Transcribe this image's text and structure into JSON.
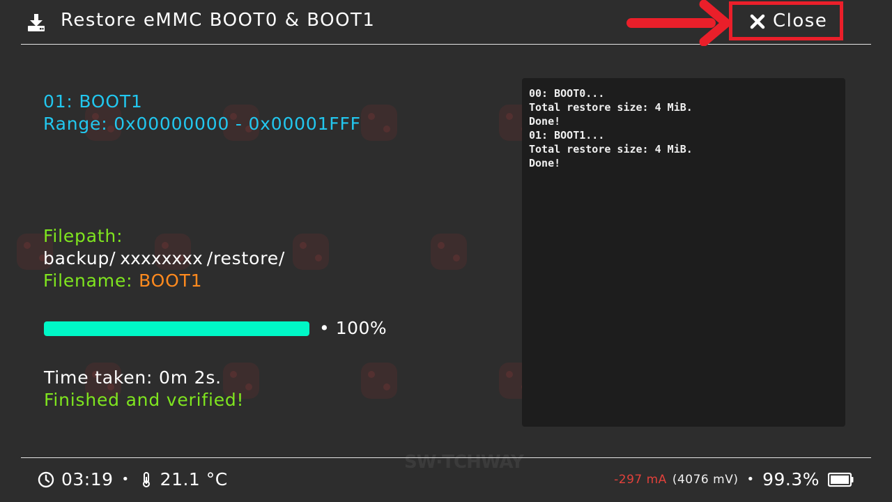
{
  "header": {
    "title": "Restore eMMC BOOT0 & BOOT1",
    "close_label": "Close"
  },
  "partition": {
    "name": "01: BOOT1",
    "range": "Range: 0x00000000 - 0x00001FFF"
  },
  "file": {
    "filepath_label": "Filepath:",
    "path_prefix": "backup/",
    "path_redacted": "xxxxxxxx",
    "path_suffix": "/restore/",
    "filename_label": "Filename:",
    "filename_value": "BOOT1"
  },
  "progress": {
    "value": 1.0,
    "text": "• 100%"
  },
  "result": {
    "time_taken": "Time taken: 0m 2s.",
    "status": "Finished and verified!"
  },
  "console": {
    "lines": [
      "00: BOOT0...",
      "Total restore size: 4 MiB.",
      "Done!",
      "01: BOOT1...",
      "Total restore size: 4 MiB.",
      "Done!"
    ]
  },
  "footer": {
    "time": "03:19",
    "temperature": "21.1 °C",
    "current": "-297 mA",
    "voltage": "(4076 mV)",
    "battery_percent": "99.3%"
  },
  "watermark_text": "SW·TCHWAY",
  "colors": {
    "background": "#2d2d2d",
    "cyan": "#22c7ef",
    "green": "#7fe51f",
    "orange": "#ff8a1e",
    "progress": "#00f7c6",
    "annotation_red": "#ea1f2a",
    "current_red": "#e2413b"
  },
  "icons": {
    "header": "download-icon",
    "close": "close-x-icon",
    "clock": "clock-icon",
    "thermometer": "thermometer-icon",
    "battery": "battery-icon"
  }
}
